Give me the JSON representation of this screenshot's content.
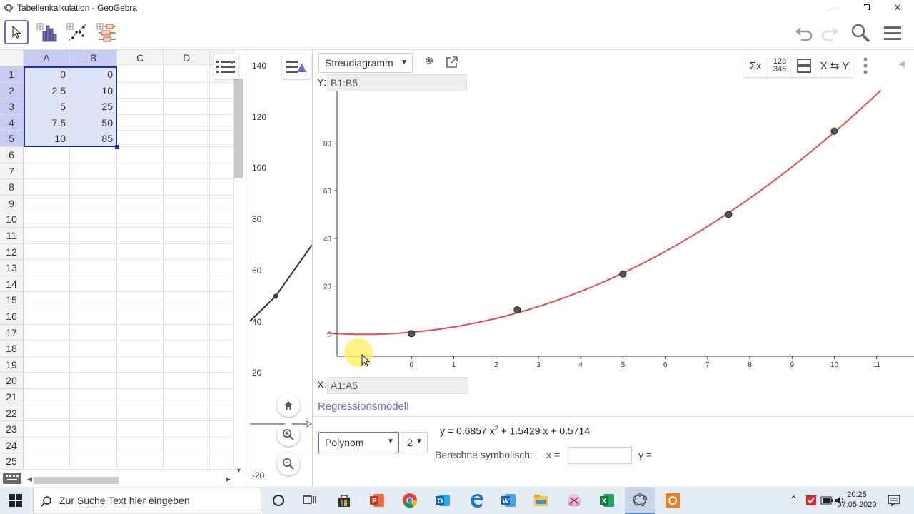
{
  "window": {
    "title": "Tabellenkalkulation - GeoGebra"
  },
  "spreadsheet": {
    "columns": [
      "A",
      "B",
      "C",
      "D"
    ],
    "rows": [
      "1",
      "2",
      "3",
      "4",
      "5",
      "6",
      "7",
      "8",
      "9",
      "10",
      "11",
      "12",
      "13",
      "14",
      "15",
      "16",
      "17",
      "18",
      "19",
      "20",
      "21",
      "22",
      "23",
      "24",
      "25"
    ],
    "data": [
      [
        "0",
        "0"
      ],
      [
        "2.5",
        "10"
      ],
      [
        "5",
        "25"
      ],
      [
        "7.5",
        "50"
      ],
      [
        "10",
        "85"
      ]
    ]
  },
  "graphics_strip": {
    "y_ticks": [
      "140",
      "120",
      "100",
      "80",
      "60",
      "40",
      "20",
      "-20"
    ]
  },
  "analysis": {
    "plot_type": "Streudiagramm",
    "y_range": "B1:B5",
    "x_range": "A1:A5",
    "y_axis_label": "Y:",
    "x_axis_label": "X:",
    "regression_link": "Regressionsmodell",
    "model": "Polynom",
    "degree": "2",
    "equation": {
      "prefix": "y = 0.6857 x",
      "exp": "2",
      "suffix": " + 1.5429 x + 0.5714"
    },
    "compute_label": "Berechne symbolisch:",
    "x_eq": "x =",
    "x_value": "",
    "y_eq": "y =",
    "stat_buttons": [
      "Σx",
      "123 345",
      "X ⇆ Y"
    ],
    "accent_color": "#6b6bc9",
    "curve_color": "#e05050",
    "point_color": "#555555"
  },
  "chart_data": {
    "type": "scatter",
    "points": [
      [
        0,
        0
      ],
      [
        2.5,
        10
      ],
      [
        5,
        25
      ],
      [
        7.5,
        50
      ],
      [
        10,
        85
      ]
    ],
    "regression": {
      "type": "polynomial",
      "degree": 2,
      "coefficients": [
        0.6857,
        1.5429,
        0.5714
      ]
    },
    "x_ticks": [
      "0",
      "1",
      "2",
      "3",
      "4",
      "5",
      "6",
      "7",
      "8",
      "9",
      "10",
      "11"
    ],
    "y_ticks": [
      "0",
      "20",
      "40",
      "60",
      "80"
    ],
    "xlim": [
      -2.2,
      11.9
    ],
    "ylim": [
      -9.5,
      102
    ]
  },
  "taskbar": {
    "search_placeholder": "Zur Suche Text hier eingeben",
    "time": "20:25",
    "date": "07.05.2020"
  }
}
